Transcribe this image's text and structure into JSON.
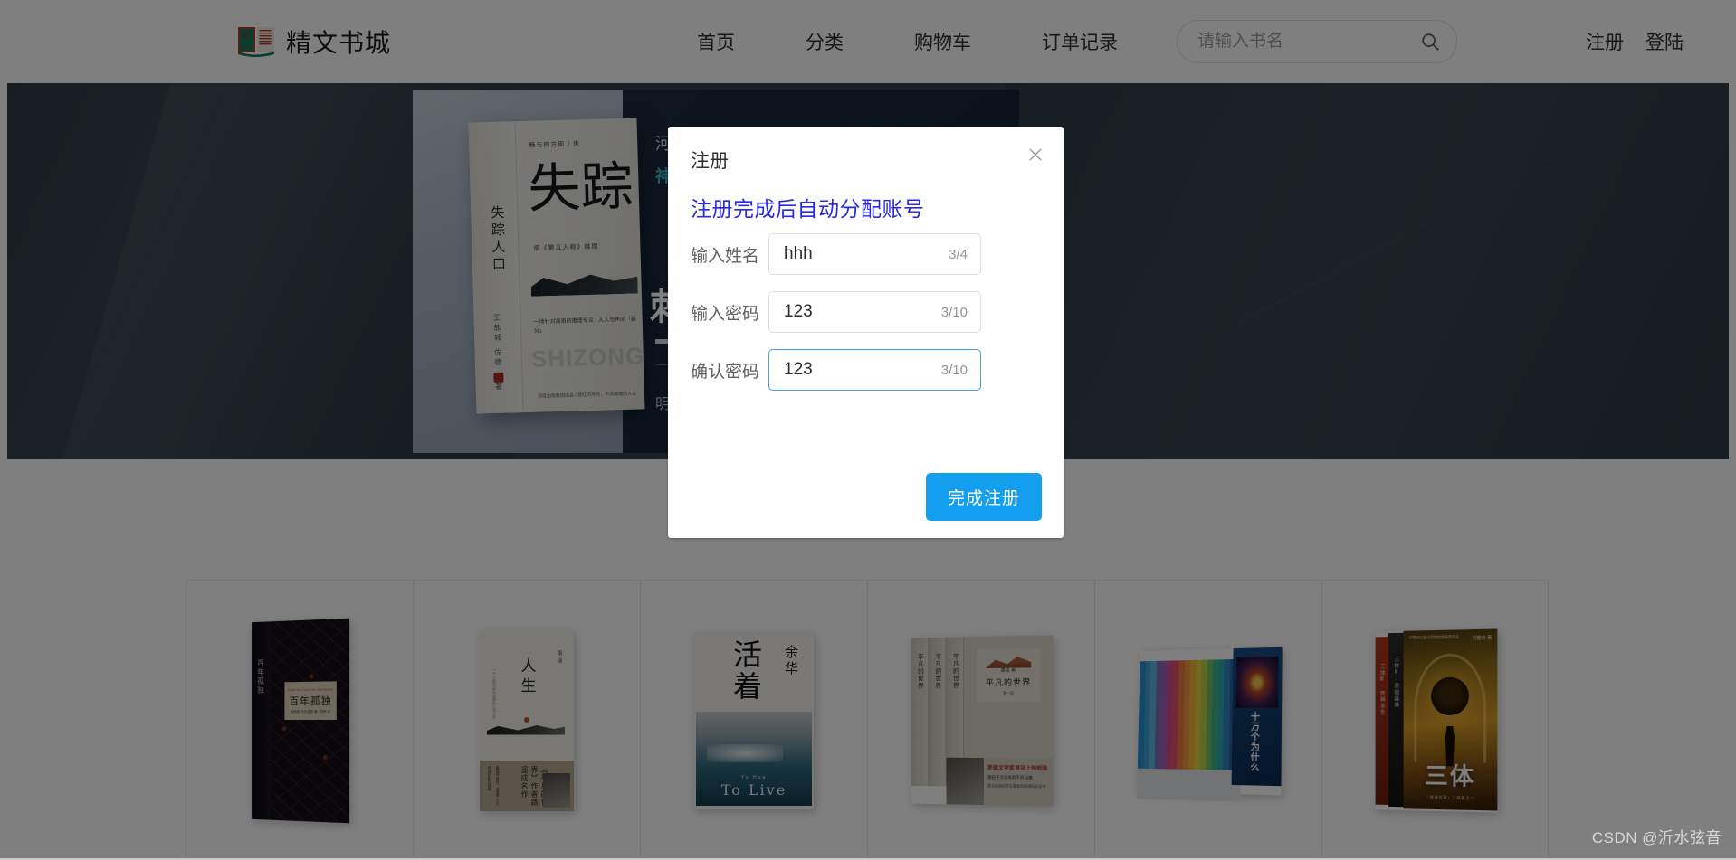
{
  "header": {
    "logo_text": "精文书城",
    "logo_icon": "open-book-icon",
    "nav": [
      {
        "label": "首页"
      },
      {
        "label": "分类"
      },
      {
        "label": "购物车"
      },
      {
        "label": "订单记录"
      }
    ],
    "search": {
      "placeholder": "请输入书名",
      "value": "",
      "icon": "search-icon"
    },
    "auth": [
      {
        "label": "注册"
      },
      {
        "label": "登陆"
      }
    ]
  },
  "banner": {
    "background_color": "#33424b",
    "slide": {
      "book": {
        "spine_title": "失踪人口",
        "spine_author": "王盐城 佐德 · 著",
        "top_line": "畅与的方面 / 失",
        "big_title": "失踪",
        "sub_line": "纲《第五人称》推理",
        "blurb": "一场针对离奇的推理专业 · 人人与声间「部分」",
        "ghost_text": "SHIZONG",
        "publisher": "深度出版集团出品 / 悲红的月光，不该消磨的人生"
      },
      "line1": "河谷",
      "line2": "神秘河谷诡事不断",
      "headline": "刺激 \\",
      "footnote": "明信片、精美书签"
    }
  },
  "books": [
    {
      "name": "百年孤独",
      "label_en": "Gabriel Garcia Marquez",
      "label_zh": "百年孤独",
      "label_author": "加西亚·马尔克斯 著 / 范晔 译",
      "spine": "百年孤独"
    },
    {
      "name": "人生",
      "title": "人生",
      "author": "路遥",
      "side_text": "一个人的命运在关键处只有几步",
      "band_text": "路遥代表作，改变千万人命运的励志经典",
      "band_big": "《平凡的世界》作者路遥成名作"
    },
    {
      "name": "活着",
      "title": "活着",
      "author": "余华",
      "en_author": "Yu Hua",
      "en_title": "To Live"
    },
    {
      "name": "平凡的世界",
      "volumes": [
        "平凡的世界",
        "平凡的世界",
        "平凡的世界"
      ],
      "label_author": "路遥 著",
      "label_zh": "平凡的世界",
      "label_no": "第一部",
      "band_line1": "茅盾文学奖皇冠上的明珠",
      "band_line2": "激励千万青年的不朽经典",
      "band_line3": "居全国高校学生最爱的新课标必读书"
    },
    {
      "name": "十万个为什么",
      "title": "十万个为什么"
    },
    {
      "name": "三体",
      "spine1": "三体Ⅲ · 死神永生",
      "spine2": "三体Ⅱ · 黑暗森林",
      "title": "三体",
      "author": "刘慈欣 著",
      "top_text": "中国科幻银河奖特别奖获奖作品",
      "sub_text": "「地球往事」三部曲之一"
    }
  ],
  "modal": {
    "title": "注册",
    "close_icon": "close-icon",
    "note": "注册完成后自动分配账号",
    "fields": [
      {
        "label": "输入姓名",
        "value": "hhh",
        "counter": "3/4",
        "focused": false
      },
      {
        "label": "输入密码",
        "value": "123",
        "counter": "3/10",
        "focused": false
      },
      {
        "label": "确认密码",
        "value": "123",
        "counter": "3/10",
        "focused": true
      }
    ],
    "submit_label": "完成注册",
    "primary_color": "#139ef0",
    "note_color": "#2929e8",
    "focus_color": "#409eff"
  },
  "watermark": "CSDN @沂水弦音"
}
